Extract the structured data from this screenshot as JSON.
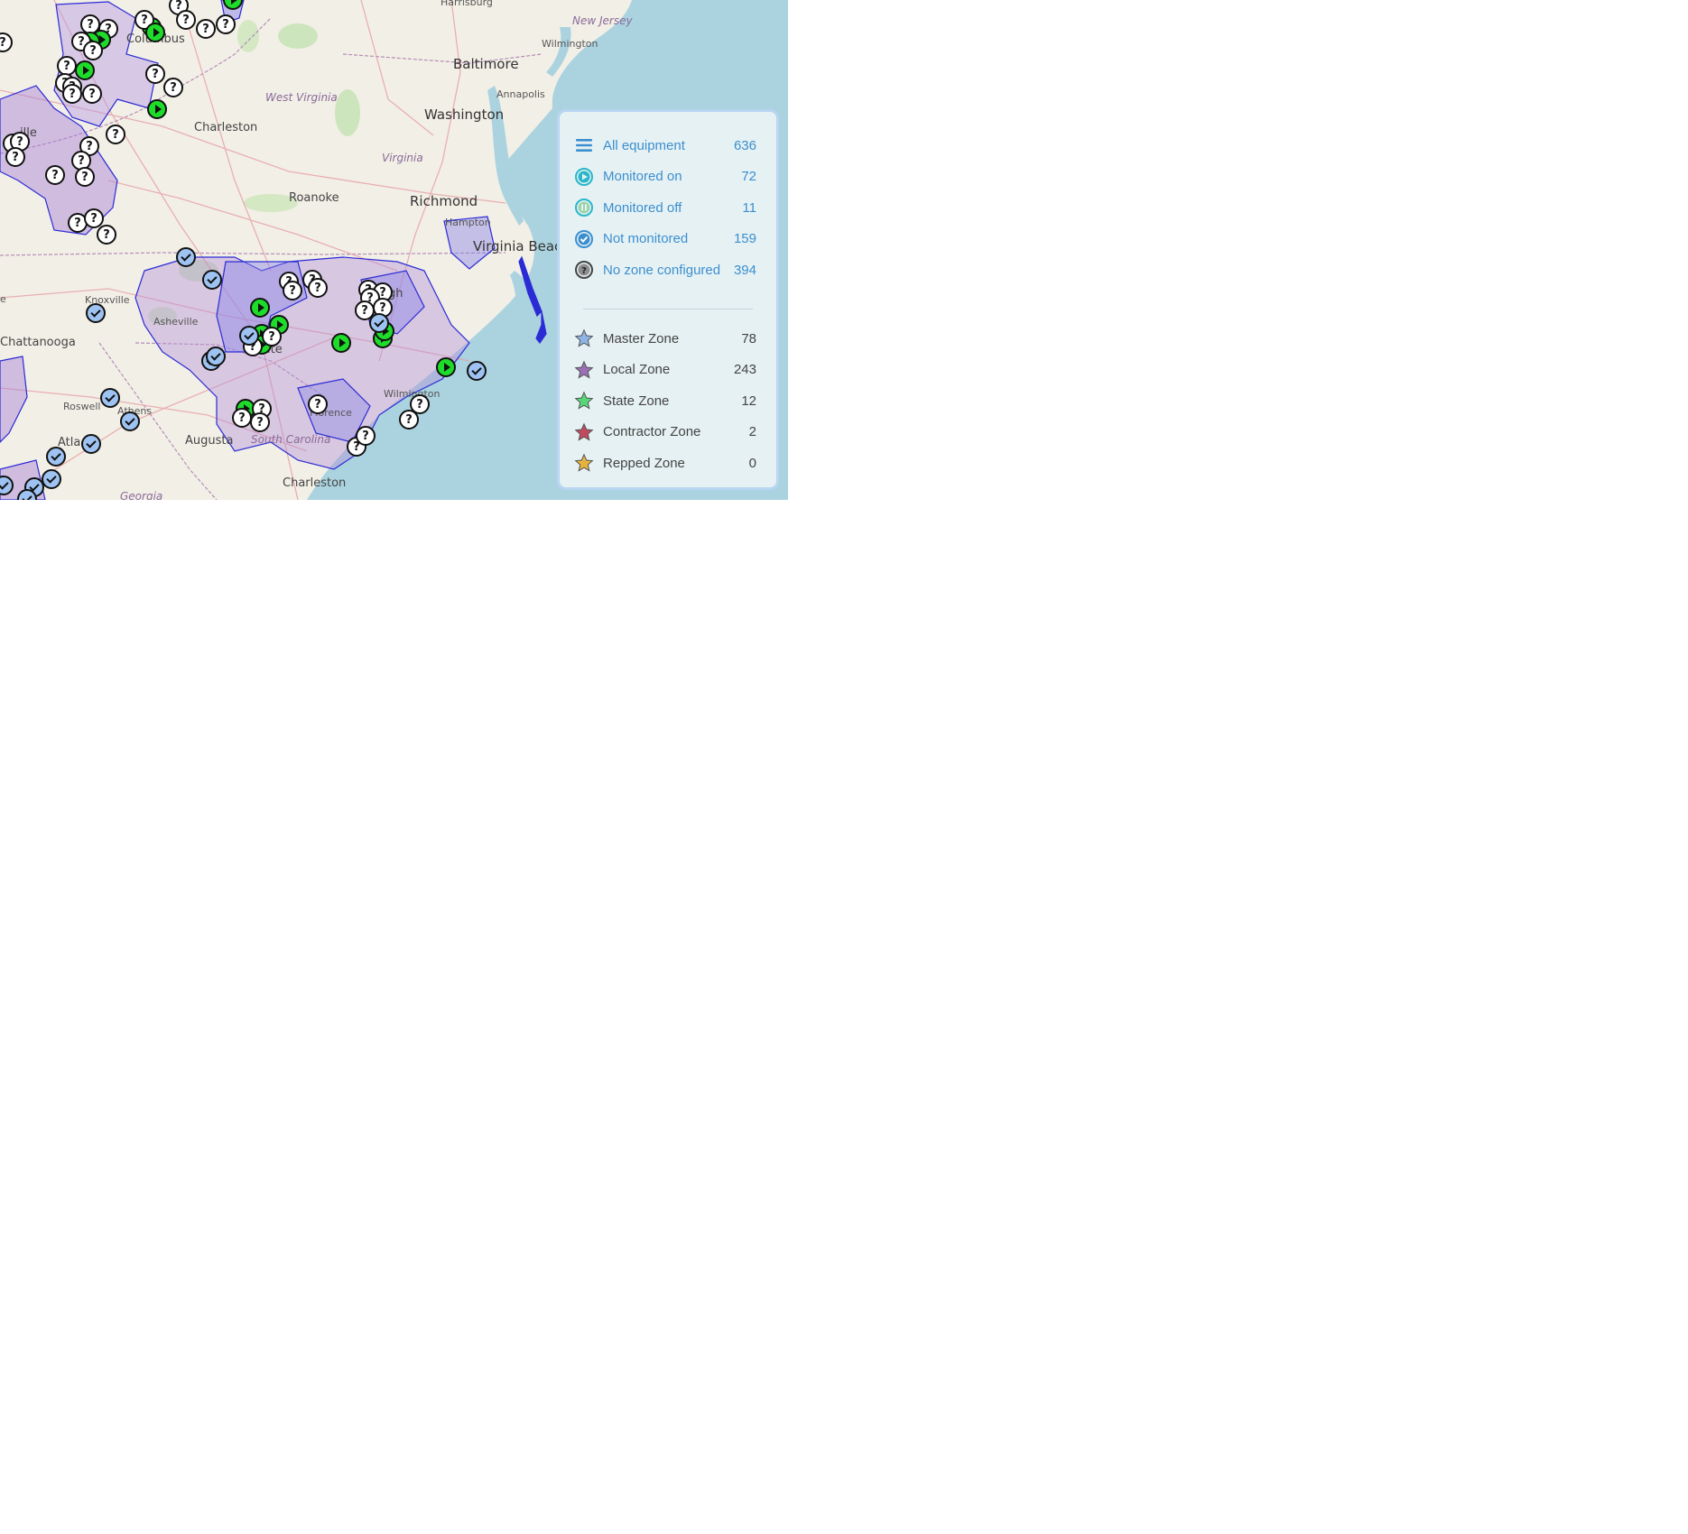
{
  "map": {
    "places": [
      {
        "name": "Harrisburg",
        "cls": "small"
      },
      {
        "name": "New Jersey",
        "cls": "state"
      },
      {
        "name": "Wilmington",
        "cls": "small"
      },
      {
        "name": "Baltimore",
        "cls": "big"
      },
      {
        "name": "Annapolis",
        "cls": "small"
      },
      {
        "name": "Washington",
        "cls": "big"
      },
      {
        "name": "West Virginia",
        "cls": "state"
      },
      {
        "name": "Charleston",
        "cls": "mid"
      },
      {
        "name": "Virginia",
        "cls": "state"
      },
      {
        "name": "Roanoke",
        "cls": "mid"
      },
      {
        "name": "Richmond",
        "cls": "big"
      },
      {
        "name": "Hampton",
        "cls": "small"
      },
      {
        "name": "Virginia Beach",
        "cls": "big"
      },
      {
        "name": "Knoxville",
        "cls": "small"
      },
      {
        "name": "Asheville",
        "cls": "small"
      },
      {
        "name": "Chattanooga",
        "cls": "mid"
      },
      {
        "name": "Roswell",
        "cls": "small"
      },
      {
        "name": "Athens",
        "cls": "small"
      },
      {
        "name": "Atla",
        "cls": "mid"
      },
      {
        "name": "Augusta",
        "cls": "mid"
      },
      {
        "name": "South Carolina",
        "cls": "state"
      },
      {
        "name": "Florence",
        "cls": "small"
      },
      {
        "name": "Wilmington",
        "cls": "small"
      },
      {
        "name": "Charleston",
        "cls": "mid"
      },
      {
        "name": "Georgia",
        "cls": "state"
      },
      {
        "name": "Columbus",
        "cls": "mid"
      },
      {
        "name": "ille",
        "cls": "mid"
      },
      {
        "name": "ite",
        "cls": "mid"
      },
      {
        "name": "gh",
        "cls": "mid"
      },
      {
        "name": "e",
        "cls": "small"
      }
    ]
  },
  "legend": {
    "status_items": [
      {
        "label": "All equipment",
        "count": "636",
        "icon": "list-icon",
        "color": "#3b8fd0"
      },
      {
        "label": "Monitored on",
        "count": "72",
        "icon": "play-circle-icon",
        "color": "#29b7c9"
      },
      {
        "label": "Monitored off",
        "count": "11",
        "icon": "pause-circle-icon",
        "color": "#9ed3a9"
      },
      {
        "label": "Not monitored",
        "count": "159",
        "icon": "check-circle-icon",
        "color": "#3b8fd0"
      },
      {
        "label": "No zone configured",
        "count": "394",
        "icon": "question-circle-icon",
        "color": "#444444"
      }
    ],
    "zone_items": [
      {
        "label": "Master Zone",
        "count": "78",
        "icon": "star-icon",
        "color": "#8fb4e6"
      },
      {
        "label": "Local Zone",
        "count": "243",
        "icon": "star-icon",
        "color": "#9a6fb5"
      },
      {
        "label": "State Zone",
        "count": "12",
        "icon": "star-icon",
        "color": "#58d67a"
      },
      {
        "label": "Contractor Zone",
        "count": "2",
        "icon": "star-icon",
        "color": "#c24a5e"
      },
      {
        "label": "Repped Zone",
        "count": "0",
        "icon": "star-icon",
        "color": "#e6b43c"
      }
    ]
  }
}
